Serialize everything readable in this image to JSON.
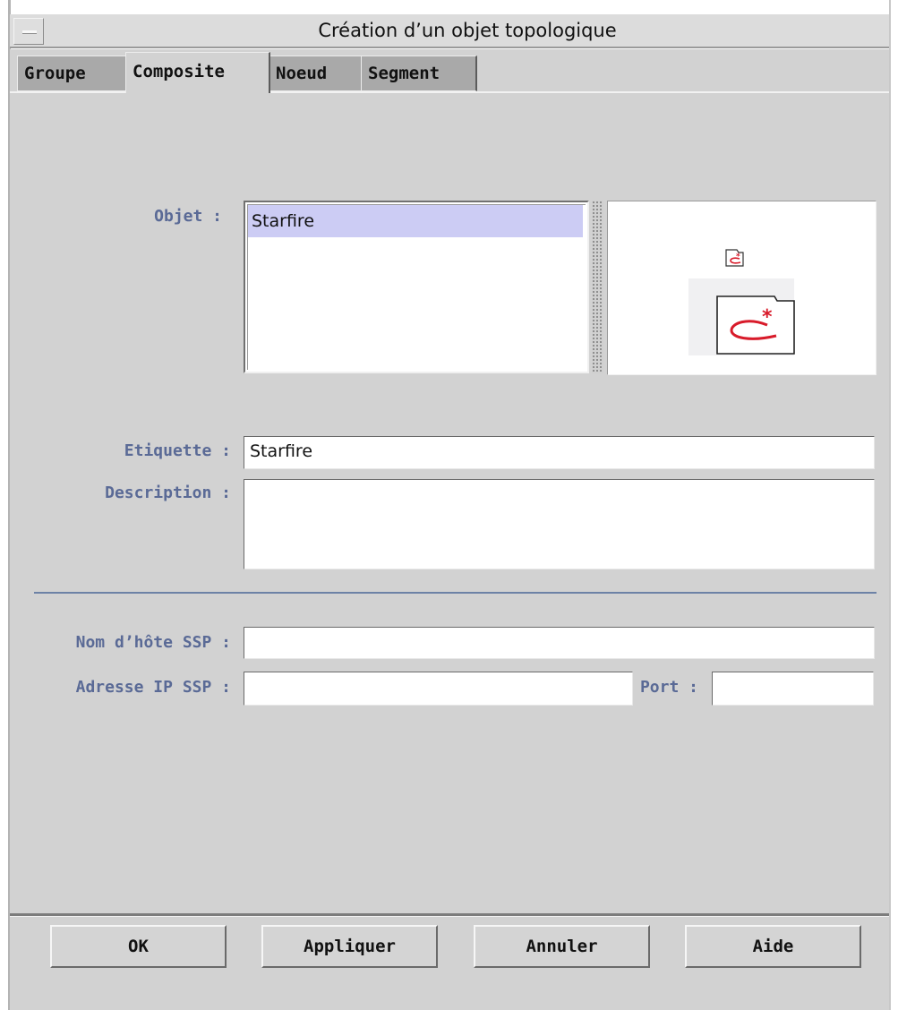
{
  "window": {
    "title": "Création d’un objet topologique"
  },
  "tabs": [
    {
      "label": "Groupe",
      "active": false
    },
    {
      "label": "Composite",
      "active": true
    },
    {
      "label": "Noeud",
      "active": false
    },
    {
      "label": "Segment",
      "active": false
    }
  ],
  "form": {
    "objet_label": "Objet :",
    "objet_items": [
      "Starfire"
    ],
    "objet_selected": "Starfire",
    "etiquette_label": "Etiquette :",
    "etiquette_value": "Starfire",
    "description_label": "Description :",
    "description_value": "",
    "hostname_label": "Nom d’hôte SSP :",
    "hostname_value": "",
    "ip_label": "Adresse IP SSP :",
    "ip_value": "",
    "port_label": "Port :",
    "port_value": ""
  },
  "preview": {
    "icons": [
      "composite-folder-icon-small",
      "composite-folder-icon-large"
    ],
    "accent_color": "#d81b2a"
  },
  "buttons": {
    "ok": "OK",
    "apply": "Appliquer",
    "cancel": "Annuler",
    "help": "Aide"
  },
  "colors": {
    "label": "#5a6a96",
    "selection": "#ccccf4",
    "panel": "#d2d2d2"
  }
}
